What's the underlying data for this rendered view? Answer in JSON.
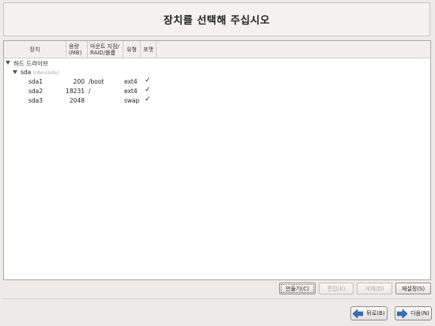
{
  "header": {
    "title": "장치를 선택해 주십시오"
  },
  "table": {
    "columns": {
      "device": "장치",
      "size": "용량\n(MB)",
      "mount": "마운트 지점/\nRAID/볼륨",
      "type": "유형",
      "format": "포맷"
    },
    "groups": [
      {
        "label": "하드 드라이브",
        "disks": [
          {
            "name": "sda",
            "path": "(/dev/sda)",
            "partitions": [
              {
                "name": "sda1",
                "size": "200",
                "mount": "/boot",
                "type": "ext4",
                "format": "✓"
              },
              {
                "name": "sda2",
                "size": "18231",
                "mount": "/",
                "type": "ext4",
                "format": "✓"
              },
              {
                "name": "sda3",
                "size": "2048",
                "mount": "",
                "type": "swap",
                "format": "✓"
              }
            ]
          }
        ]
      }
    ]
  },
  "actions": {
    "create": "만들기(C)",
    "edit": "편집(E)",
    "delete": "삭제(D)",
    "reset": "재설정(S)"
  },
  "nav": {
    "back": "뒤로(B)",
    "next": "다음(N)"
  },
  "colors": {
    "arrow_blue": "#3a6fb5"
  }
}
